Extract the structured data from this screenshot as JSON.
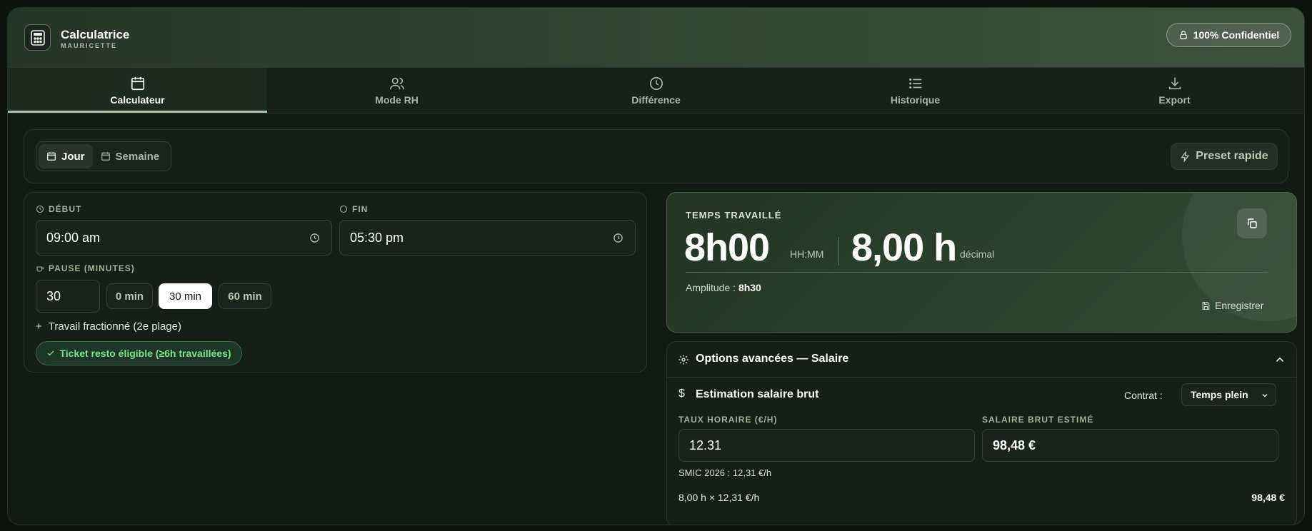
{
  "header": {
    "app_title": "Calculatrice",
    "app_subtitle": "MAURICETTE",
    "confidential_badge": "100% Confidentiel"
  },
  "tabs": [
    {
      "label": "Calculateur",
      "icon": "calendar-icon",
      "active": true
    },
    {
      "label": "Mode RH",
      "icon": "users-icon",
      "active": false
    },
    {
      "label": "Différence",
      "icon": "clock-icon",
      "active": false
    },
    {
      "label": "Historique",
      "icon": "list-icon",
      "active": false
    },
    {
      "label": "Export",
      "icon": "download-icon",
      "active": false
    }
  ],
  "mode": {
    "day_label": "Jour",
    "week_label": "Semaine",
    "selected": "Jour",
    "preset_label": "Preset rapide"
  },
  "inputs": {
    "start_label": "DÉBUT",
    "start_value": "09:00 am",
    "end_label": "FIN",
    "end_value": "05:30 pm",
    "pause_label": "PAUSE (MINUTES)",
    "pause_value": "30",
    "pause_chips": [
      "0 min",
      "30 min",
      "60 min"
    ],
    "pause_selected": "30 min",
    "split_label": "Travail fractionné (2e plage)",
    "ticket_label": "Ticket resto éligible (≥6h travaillées)"
  },
  "result": {
    "label": "TEMPS TRAVAILLÉ",
    "hhmm_value": "8h00",
    "hhmm_unit": "HH:MM",
    "decimal_value": "8,00 h",
    "decimal_unit": "décimal",
    "amplitude_label": "Amplitude :",
    "amplitude_value": "8h30",
    "save_label": "Enregistrer"
  },
  "advanced": {
    "title": "Options avancées — Salaire",
    "estimate_title": "Estimation salaire brut",
    "contract_label": "Contrat :",
    "contract_value": "Temps plein",
    "rate_label": "TAUX HORAIRE (€/H)",
    "rate_value": "12.31",
    "salary_label": "SALAIRE BRUT ESTIMÉ",
    "salary_value": "98,48 €",
    "smic_note": "SMIC 2026 : 12,31 €/h",
    "calc_line": "8,00 h × 12,31 €/h",
    "calc_total": "98,48 €"
  },
  "colors": {
    "accent": "#a7c9a2",
    "ticket_green": "#7fe08f",
    "background": "#0d120e"
  }
}
